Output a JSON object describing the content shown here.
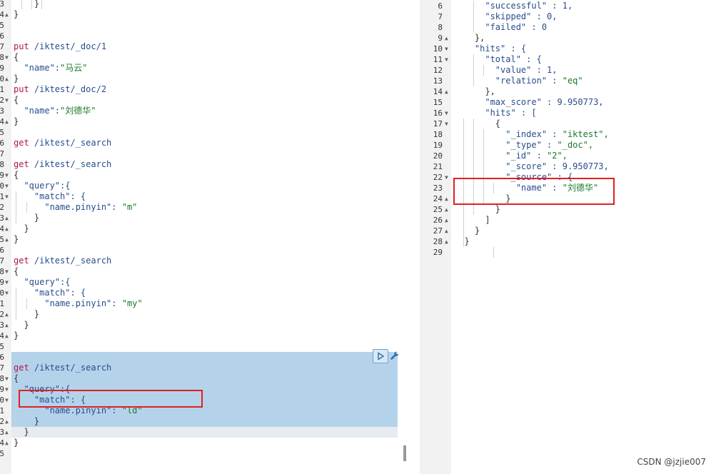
{
  "left_editor": {
    "gutter_labels": [
      "3",
      "4",
      "5",
      "6",
      "7",
      "8",
      "9",
      "0",
      "1",
      "2",
      "3",
      "4",
      "5",
      "6",
      "7",
      "8",
      "9",
      "0",
      "1",
      "2",
      "3",
      "4",
      "5",
      "6",
      "7",
      "8",
      "9",
      "0",
      "1",
      "2",
      "3",
      "4",
      "5",
      "6",
      "7",
      "8",
      "9",
      "0",
      "1",
      "2",
      "3",
      "4",
      "5"
    ],
    "lines": [
      [
        {
          "t": "    }",
          "c": "punc"
        }
      ],
      [
        {
          "t": "}",
          "c": "punc"
        }
      ],
      [],
      [],
      [
        {
          "t": "put ",
          "c": "kw"
        },
        {
          "t": "/iktest/_doc/1",
          "c": "url"
        }
      ],
      [
        {
          "t": "{",
          "c": "punc"
        }
      ],
      [
        {
          "t": "  \"name\":",
          "c": "key"
        },
        {
          "t": "\"马云\"",
          "c": "str"
        }
      ],
      [
        {
          "t": "}",
          "c": "punc"
        }
      ],
      [
        {
          "t": "put ",
          "c": "kw"
        },
        {
          "t": "/iktest/_doc/2",
          "c": "url"
        }
      ],
      [
        {
          "t": "{",
          "c": "punc"
        }
      ],
      [
        {
          "t": "  \"name\":",
          "c": "key"
        },
        {
          "t": "\"刘德华\"",
          "c": "str"
        }
      ],
      [
        {
          "t": "}",
          "c": "punc"
        }
      ],
      [],
      [
        {
          "t": "get ",
          "c": "kw"
        },
        {
          "t": "/iktest/_search",
          "c": "url"
        }
      ],
      [],
      [
        {
          "t": "get ",
          "c": "kw"
        },
        {
          "t": "/iktest/_search",
          "c": "url"
        }
      ],
      [
        {
          "t": "{",
          "c": "punc"
        }
      ],
      [
        {
          "t": "  \"query\":{",
          "c": "key"
        }
      ],
      [
        {
          "t": "    \"match\": {",
          "c": "key"
        }
      ],
      [
        {
          "t": "      \"name.pinyin\": ",
          "c": "key"
        },
        {
          "t": "\"m\"",
          "c": "str"
        }
      ],
      [
        {
          "t": "    }",
          "c": "punc"
        }
      ],
      [
        {
          "t": "  }",
          "c": "punc"
        }
      ],
      [
        {
          "t": "}",
          "c": "punc"
        }
      ],
      [],
      [
        {
          "t": "get ",
          "c": "kw"
        },
        {
          "t": "/iktest/_search",
          "c": "url"
        }
      ],
      [
        {
          "t": "{",
          "c": "punc"
        }
      ],
      [
        {
          "t": "  \"query\":{",
          "c": "key"
        }
      ],
      [
        {
          "t": "    \"match\": {",
          "c": "key"
        }
      ],
      [
        {
          "t": "      \"name.pinyin\": ",
          "c": "key"
        },
        {
          "t": "\"my\"",
          "c": "str"
        }
      ],
      [
        {
          "t": "    }",
          "c": "punc"
        }
      ],
      [
        {
          "t": "  }",
          "c": "punc"
        }
      ],
      [
        {
          "t": "}",
          "c": "punc"
        }
      ],
      [],
      [],
      [
        {
          "t": "get ",
          "c": "kw"
        },
        {
          "t": "/iktest/_search",
          "c": "url"
        }
      ],
      [
        {
          "t": "{",
          "c": "punc"
        }
      ],
      [
        {
          "t": "  \"query\":{",
          "c": "key"
        }
      ],
      [
        {
          "t": "    \"match\": {",
          "c": "key"
        }
      ],
      [
        {
          "t": "      \"name.pinyin\": ",
          "c": "key"
        },
        {
          "t": "\"ld\"",
          "c": "str"
        }
      ],
      [
        {
          "t": "    }",
          "c": "punc"
        }
      ],
      [
        {
          "t": "  }",
          "c": "punc"
        }
      ],
      [
        {
          "t": "}",
          "c": "punc"
        }
      ],
      []
    ],
    "fold_markers": {
      "1": "▲",
      "5": "▼",
      "7": "▲",
      "9": "▼",
      "11": "▲",
      "16": "▼",
      "17": "▼",
      "18": "▼",
      "20": "▲",
      "21": "▲",
      "22": "▲",
      "25": "▼",
      "26": "▼",
      "27": "▼",
      "29": "▲",
      "30": "▲",
      "31": "▲",
      "35": "▼",
      "36": "▼",
      "37": "▼",
      "39": "▲",
      "40": "▲",
      "41": "▲"
    }
  },
  "right_editor": {
    "lines": [
      {
        "n": "6",
        "f": "",
        "seg": [
          {
            "t": "      \"successful\" : ",
            "c": "key"
          },
          {
            "t": "1,",
            "c": "num"
          }
        ]
      },
      {
        "n": "7",
        "f": "",
        "seg": [
          {
            "t": "      \"skipped\" : ",
            "c": "key"
          },
          {
            "t": "0,",
            "c": "num"
          }
        ]
      },
      {
        "n": "8",
        "f": "",
        "seg": [
          {
            "t": "      \"failed\" : ",
            "c": "key"
          },
          {
            "t": "0",
            "c": "num"
          }
        ]
      },
      {
        "n": "9",
        "f": "▲",
        "seg": [
          {
            "t": "    },",
            "c": "punc"
          }
        ]
      },
      {
        "n": "10",
        "f": "▼",
        "seg": [
          {
            "t": "    \"hits\" : {",
            "c": "key"
          }
        ]
      },
      {
        "n": "11",
        "f": "▼",
        "seg": [
          {
            "t": "      \"total\" : {",
            "c": "key"
          }
        ]
      },
      {
        "n": "12",
        "f": "",
        "seg": [
          {
            "t": "        \"value\" : ",
            "c": "key"
          },
          {
            "t": "1,",
            "c": "num"
          }
        ]
      },
      {
        "n": "13",
        "f": "",
        "seg": [
          {
            "t": "        \"relation\" : ",
            "c": "key"
          },
          {
            "t": "\"eq\"",
            "c": "str"
          }
        ]
      },
      {
        "n": "14",
        "f": "▲",
        "seg": [
          {
            "t": "      },",
            "c": "punc"
          }
        ]
      },
      {
        "n": "15",
        "f": "",
        "seg": [
          {
            "t": "      \"max_score\" : ",
            "c": "key"
          },
          {
            "t": "9.950773,",
            "c": "num"
          }
        ]
      },
      {
        "n": "16",
        "f": "▼",
        "seg": [
          {
            "t": "      \"hits\" : [",
            "c": "key"
          }
        ]
      },
      {
        "n": "17",
        "f": "▼",
        "seg": [
          {
            "t": "        {",
            "c": "punc"
          }
        ]
      },
      {
        "n": "18",
        "f": "",
        "seg": [
          {
            "t": "          \"_index\" : ",
            "c": "key"
          },
          {
            "t": "\"iktest\",",
            "c": "str"
          }
        ]
      },
      {
        "n": "19",
        "f": "",
        "seg": [
          {
            "t": "          \"_type\" : ",
            "c": "key"
          },
          {
            "t": "\"_doc\",",
            "c": "str"
          }
        ]
      },
      {
        "n": "20",
        "f": "",
        "seg": [
          {
            "t": "          \"_id\" : ",
            "c": "key"
          },
          {
            "t": "\"2\",",
            "c": "str"
          }
        ]
      },
      {
        "n": "21",
        "f": "",
        "seg": [
          {
            "t": "          \"_score\" : ",
            "c": "key"
          },
          {
            "t": "9.950773,",
            "c": "num"
          }
        ]
      },
      {
        "n": "22",
        "f": "▼",
        "seg": [
          {
            "t": "          \"_source\" : {",
            "c": "key"
          }
        ]
      },
      {
        "n": "23",
        "f": "",
        "seg": [
          {
            "t": "            \"name\" : ",
            "c": "key"
          },
          {
            "t": "\"刘德华\"",
            "c": "str"
          }
        ]
      },
      {
        "n": "24",
        "f": "▲",
        "seg": [
          {
            "t": "          }",
            "c": "punc"
          }
        ]
      },
      {
        "n": "25",
        "f": "▲",
        "seg": [
          {
            "t": "        }",
            "c": "punc"
          }
        ]
      },
      {
        "n": "26",
        "f": "▲",
        "seg": [
          {
            "t": "      ]",
            "c": "punc"
          }
        ]
      },
      {
        "n": "27",
        "f": "▲",
        "seg": [
          {
            "t": "    }",
            "c": "punc"
          }
        ]
      },
      {
        "n": "28",
        "f": "▲",
        "seg": [
          {
            "t": "  }",
            "c": "punc"
          }
        ]
      },
      {
        "n": "29",
        "f": "",
        "seg": []
      }
    ]
  },
  "divider_glyph": "||",
  "toolbar": {
    "run_icon": "play-icon",
    "settings_icon": "wrench-icon"
  },
  "watermark": "CSDN @jzjie007",
  "colors": {
    "selection": "#b4d3ea",
    "highlight_box": "#e02020",
    "keyword": "#b0164f",
    "string": "#1a7a2a",
    "key": "#284d8e"
  }
}
